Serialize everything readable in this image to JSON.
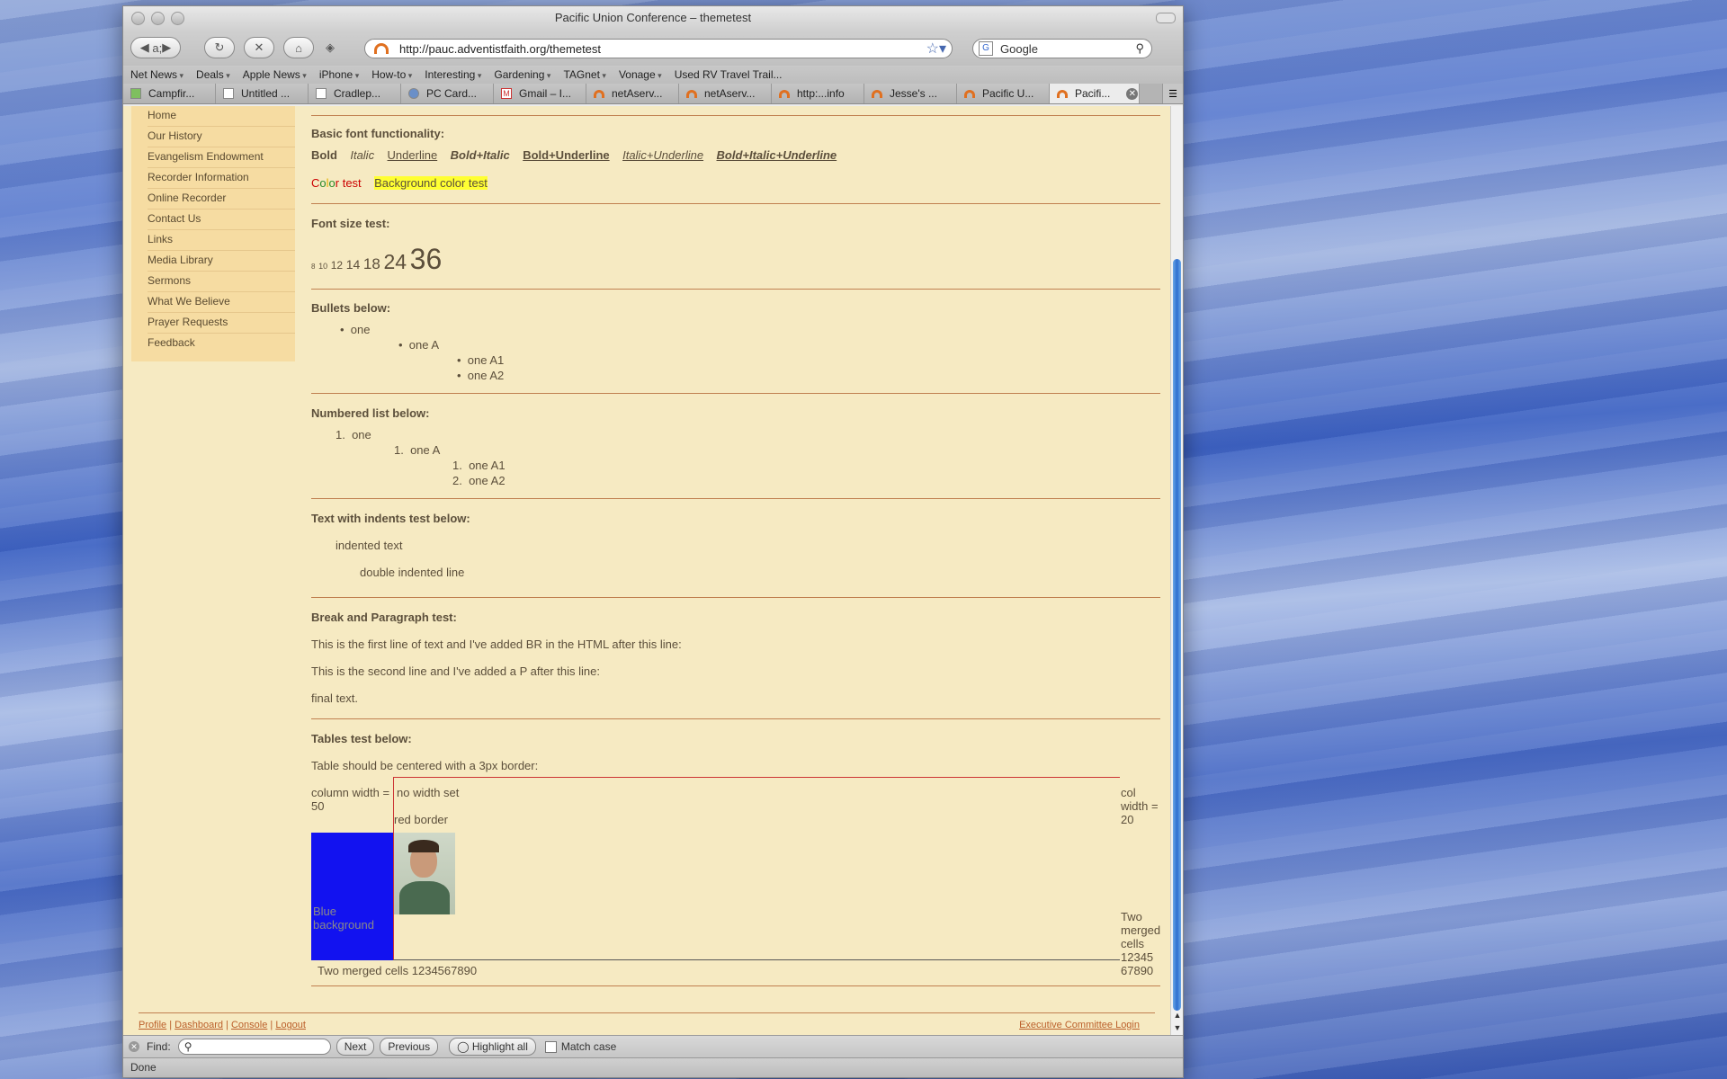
{
  "window": {
    "title": "Pacific Union Conference – themetest"
  },
  "toolbar": {
    "url": "http://pauc.adventistfaith.org/themetest",
    "search_placeholder": "Google"
  },
  "bookmarks": [
    "Net News",
    "Deals",
    "Apple News",
    "iPhone",
    "How-to",
    "Interesting",
    "Gardening",
    "TAGnet",
    "Vonage",
    "Used RV Travel Trail..."
  ],
  "tabs": [
    "Campfir...",
    "Untitled ...",
    "Cradlep...",
    "PC Card...",
    "Gmail – I...",
    "netAserv...",
    "netAserv...",
    "http:...info",
    "Jesse's ...",
    "Pacific U...",
    "Pacifi..."
  ],
  "sidebar": {
    "items": [
      "Home",
      "Our History",
      "Evangelism Endowment",
      "Recorder Information",
      "Online Recorder",
      "Contact Us",
      "Links",
      "Media Library",
      "Sermons",
      "What We Believe",
      "Prayer Requests",
      "Feedback"
    ]
  },
  "content": {
    "basic_heading": "Basic font functionality:",
    "fonts": {
      "bold": "Bold",
      "italic": "Italic",
      "underline": "Underline",
      "bold_italic": "Bold+Italic",
      "bold_underline": "Bold+Underline",
      "italic_underline": "Italic+Underline",
      "bold_italic_underline": "Bold+Italic+Underline"
    },
    "color_test": {
      "c1": "C",
      "c2": "o",
      "c3": "l",
      "c4": "o",
      "c5": "r",
      "rest": " test",
      "background": "Background color test"
    },
    "colors": {
      "red": "#cc0000",
      "yellow_bg": "#ffff33",
      "blue_cell": "#1212f0"
    },
    "fontsize_heading": "Font size test:",
    "sizes": [
      "8",
      "10",
      "12",
      "14",
      "18",
      "24",
      "36"
    ],
    "bullets_heading": "Bullets below:",
    "bullets": {
      "one": "one",
      "one_a": "one A",
      "one_a1": "one A1",
      "one_a2": "one A2"
    },
    "numbered_heading": "Numbered list below:",
    "numbered": {
      "n1": "1.",
      "one": "one",
      "n1b": "1.",
      "one_a": "one A",
      "n1c": "1.",
      "one_a1": "one A1",
      "n2": "2.",
      "one_a2": "one A2"
    },
    "indent_heading": "Text with indents test below:",
    "indented": "indented text",
    "double_indented": "double indented line",
    "break_heading": "Break and Paragraph test:",
    "break_line1": "This is the first line of text and I've added BR in the HTML after this line:",
    "break_line2": "This is the second line and I've added a P after this line:",
    "break_final": "final text.",
    "tables_heading": "Tables test below:",
    "tables_note": "Table should be centered with a 3px border:",
    "table": {
      "col50": "column width = 50",
      "no_width": "no width set",
      "red_border": "red border",
      "col20": "col width = 20",
      "blue_bg": "Blue background",
      "merged_right": "Two merged cells 12345 67890",
      "merged_bottom": "Two merged cells 1234567890"
    }
  },
  "footer": {
    "profile": "Profile",
    "dashboard": "Dashboard",
    "console": "Console",
    "logout": "Logout",
    "sep": "|",
    "exec_login": "Executive Committee Login"
  },
  "findbar": {
    "label": "Find:",
    "next": "Next",
    "previous": "Previous",
    "highlight": "Highlight all",
    "match_case": "Match case"
  },
  "status": "Done"
}
